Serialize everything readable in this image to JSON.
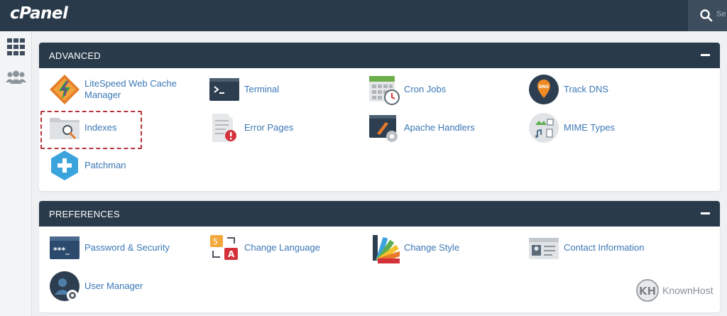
{
  "app": {
    "logo_text": "cPanel"
  },
  "search": {
    "placeholder": "Se"
  },
  "sidebar": {
    "items": [
      {
        "name": "grid-icon"
      },
      {
        "name": "users-icon"
      }
    ]
  },
  "sections": [
    {
      "title": "ADVANCED",
      "items": [
        {
          "label": "LiteSpeed Web Cache Manager",
          "icon": "litespeed-icon"
        },
        {
          "label": "Terminal",
          "icon": "terminal-icon"
        },
        {
          "label": "Cron Jobs",
          "icon": "calendar-clock-icon"
        },
        {
          "label": "Track DNS",
          "icon": "dns-pin-icon"
        },
        {
          "label": "Indexes",
          "icon": "folder-search-icon"
        },
        {
          "label": "Error Pages",
          "icon": "error-document-icon"
        },
        {
          "label": "Apache Handlers",
          "icon": "apache-handlers-icon"
        },
        {
          "label": "MIME Types",
          "icon": "mime-types-icon"
        },
        {
          "label": "Patchman",
          "icon": "patchman-icon"
        }
      ]
    },
    {
      "title": "PREFERENCES",
      "items": [
        {
          "label": "Password & Security",
          "icon": "password-window-icon"
        },
        {
          "label": "Change Language",
          "icon": "language-icon"
        },
        {
          "label": "Change Style",
          "icon": "color-swatches-icon"
        },
        {
          "label": "Contact Information",
          "icon": "contact-card-icon"
        },
        {
          "label": "User Manager",
          "icon": "user-gear-icon"
        }
      ]
    }
  ],
  "watermark": {
    "text": "KnownHost"
  },
  "colors": {
    "header": "#293a4a",
    "link": "#3b78b6",
    "highlight": "#b6333a"
  }
}
